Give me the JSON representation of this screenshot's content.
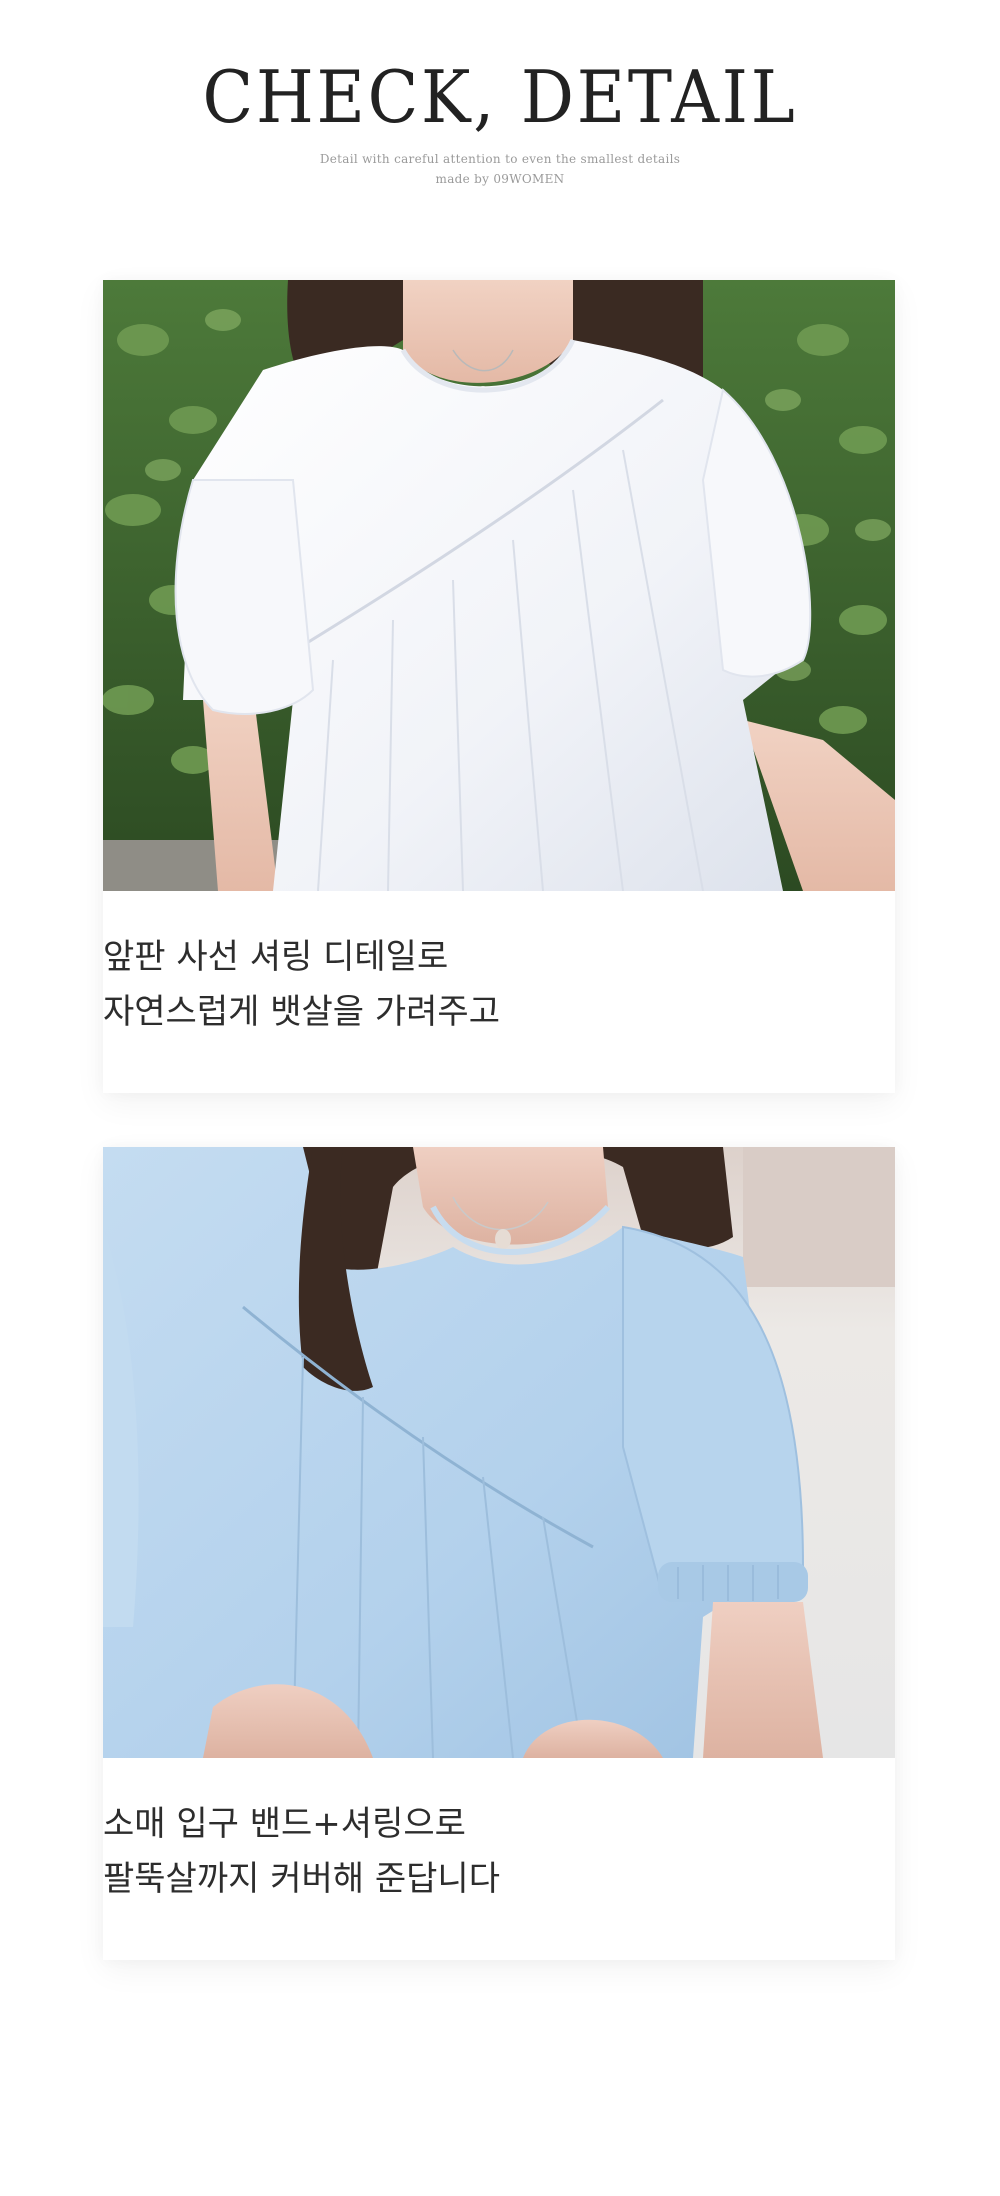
{
  "header": {
    "title": "CHECK, DETAIL",
    "subtitle_line1": "Detail with careful attention to even the smallest details",
    "subtitle_line2": "made by 09WOMEN"
  },
  "details": [
    {
      "image": "white-blouse-shirring-photo",
      "caption_line1": "앞판 사선 셔링 디테일로",
      "caption_line2": "자연스럽게 뱃살을 가려주고"
    },
    {
      "image": "skyblue-blouse-sleeve-photo",
      "caption_line1": "소매 입구 밴드+셔링으로",
      "caption_line2": "팔뚝살까지 커버해 준답니다"
    }
  ],
  "colors": {
    "background": "#ffffff",
    "title": "#222222",
    "subtitle": "#9a9a9a",
    "caption": "#2d2d2d",
    "white_blouse": "#f4f6fa",
    "blue_blouse": "#b8d6ee",
    "foliage": "#3f6a32"
  }
}
